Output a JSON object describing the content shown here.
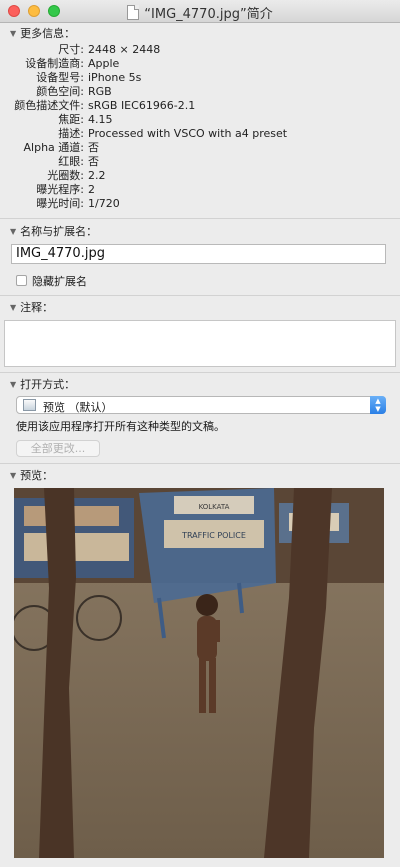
{
  "window": {
    "title": "“IMG_4770.jpg”简介"
  },
  "more_info": {
    "header": "更多信息：",
    "rows": [
      {
        "label": "尺寸:",
        "value": "2448 × 2448"
      },
      {
        "label": "设备制造商:",
        "value": "Apple"
      },
      {
        "label": "设备型号:",
        "value": "iPhone 5s"
      },
      {
        "label": "颜色空间:",
        "value": "RGB"
      },
      {
        "label": "颜色描述文件:",
        "value": "sRGB IEC61966-2.1"
      },
      {
        "label": "焦距:",
        "value": "4.15"
      },
      {
        "label": "描述:",
        "value": "Processed with VSCO with a4 preset"
      },
      {
        "label": "Alpha 通道:",
        "value": "否"
      },
      {
        "label": "红眼:",
        "value": "否"
      },
      {
        "label": "光圈数:",
        "value": "2.2"
      },
      {
        "label": "曝光程序:",
        "value": "2"
      },
      {
        "label": "曝光时间:",
        "value": "1/720"
      }
    ]
  },
  "name_ext": {
    "header": "名称与扩展名：",
    "filename": "IMG_4770.jpg",
    "hide_ext_label": "隐藏扩展名"
  },
  "comments": {
    "header": "注释："
  },
  "open_with": {
    "header": "打开方式：",
    "selected_app": "预览 （默认）",
    "hint": "使用该应用程序打开所有这种类型的文稿。",
    "change_all_label": "全部更改..."
  },
  "preview": {
    "header": "预览：",
    "sign_top": "KOLKATA",
    "sign_main": "TRAFFIC POLICE"
  }
}
